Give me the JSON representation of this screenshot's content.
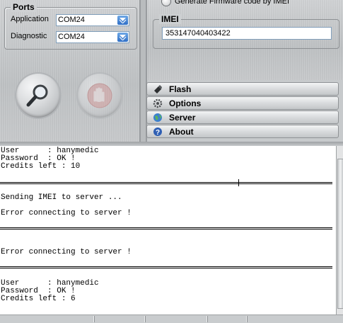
{
  "ports": {
    "title": "Ports",
    "application_label": "Application",
    "application_value": "COM24",
    "diagnostic_label": "Diagnostic",
    "diagnostic_value": "COM24"
  },
  "firmware": {
    "radio_label": "Generate Firmware code by IMEI"
  },
  "imei": {
    "title": "IMEI",
    "value": "353147040403422"
  },
  "menu": [
    {
      "label": "Flash",
      "icon": "flash-icon"
    },
    {
      "label": "Options",
      "icon": "gear-icon"
    },
    {
      "label": "Server",
      "icon": "globe-icon"
    },
    {
      "label": "About",
      "icon": "help-icon"
    }
  ],
  "buttons": {
    "search_icon": "magnifier-icon",
    "stop_icon": "stop-hand-icon"
  },
  "log": {
    "block1": [
      "User      : hanymedic",
      "Password  : OK !",
      "Credits left : 10"
    ],
    "sending": "Sending IMEI to server ...",
    "error1": "Error connecting to server !",
    "error2": "Error connecting to server !",
    "block2": [
      "User      : hanymedic",
      "Password  : OK !",
      "Credits left : 6"
    ]
  }
}
